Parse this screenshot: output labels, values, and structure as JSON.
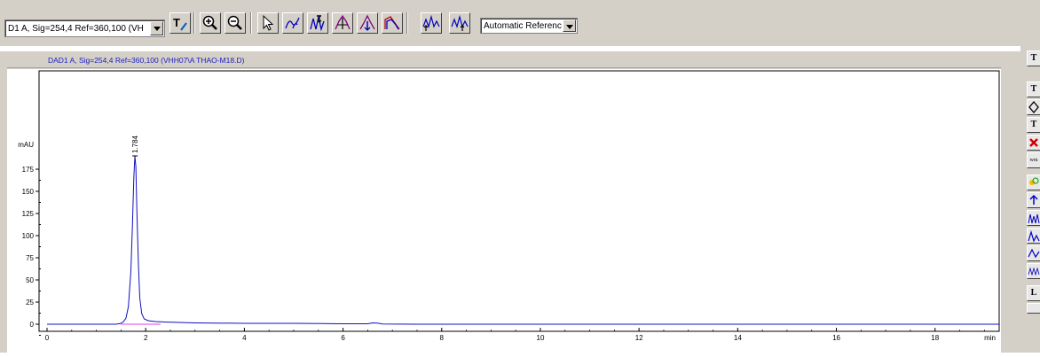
{
  "toolbar": {
    "signal_select": "D1 A, Sig=254,4 Ref=360,100 (VH",
    "reference_select": "Automatic Referenc",
    "buttons": [
      {
        "name": "text-tool-button"
      },
      {
        "name": "zoom-in-button"
      },
      {
        "name": "zoom-out-button"
      },
      {
        "name": "select-pointer-button"
      },
      {
        "name": "draw-baseline-button"
      },
      {
        "name": "manual-integration-button"
      },
      {
        "name": "split-peak-button"
      },
      {
        "name": "delete-peak-button"
      },
      {
        "name": "spectrum-button"
      },
      {
        "name": "tangent-skim-button"
      },
      {
        "name": "baseline-drop-button"
      }
    ]
  },
  "plot": {
    "header": "DAD1 A, Sig=254,4 Ref=360,100 (VHH07\\A THAO-M18.D)",
    "y_unit": "mAU",
    "x_unit": "min"
  },
  "chart_data": {
    "type": "line",
    "title": "DAD1 A, Sig=254,4 Ref=360,100 (VHH07\\A THAO-M18.D)",
    "xlabel": "min",
    "ylabel": "mAU",
    "xlim": [
      0,
      19.3
    ],
    "ylim": [
      -5,
      205
    ],
    "x_ticks": [
      0,
      2,
      4,
      6,
      8,
      10,
      12,
      14,
      16,
      18
    ],
    "y_ticks": [
      0,
      25,
      50,
      75,
      100,
      125,
      150,
      175
    ],
    "peaks": [
      {
        "rt": 1.784,
        "label": "1.784",
        "height": 190
      }
    ],
    "series": [
      {
        "color": "#1010c0",
        "x": [
          0,
          1.0,
          1.4,
          1.5,
          1.55,
          1.6,
          1.65,
          1.7,
          1.73,
          1.76,
          1.78,
          1.8,
          1.82,
          1.85,
          1.88,
          1.92,
          1.97,
          2.05,
          2.2,
          2.4,
          2.7,
          3.0,
          4.0,
          5.0,
          5.6,
          6.0,
          6.5,
          6.6,
          6.7,
          6.8,
          7.5,
          10,
          14,
          19.3
        ],
        "y": [
          0,
          0,
          0,
          1,
          3,
          7,
          20,
          60,
          110,
          165,
          190,
          178,
          130,
          70,
          30,
          12,
          6,
          4,
          3,
          2.5,
          2,
          1.5,
          1,
          1,
          0.8,
          0.5,
          0.5,
          1.5,
          1.2,
          0.3,
          0,
          0,
          0,
          0
        ]
      }
    ],
    "baseline": {
      "color": "#e040e0",
      "x": [
        1.5,
        2.3
      ],
      "y": [
        0,
        0
      ]
    }
  }
}
